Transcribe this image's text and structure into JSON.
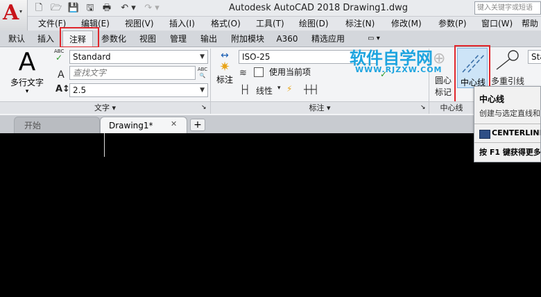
{
  "window": {
    "title": "Autodesk AutoCAD 2018    Drawing1.dwg",
    "search_placeholder": "键入关键字或短语"
  },
  "app_button": {
    "logo": "A",
    "caret": "▾"
  },
  "quick_access": {
    "new": "🗋",
    "open": "🗁",
    "save": "💾",
    "saveas": "🖫",
    "print": "🖶",
    "undo": "↶ ▾",
    "redo": "↷ ▾"
  },
  "menu": [
    "文件(F)",
    "编辑(E)",
    "视图(V)",
    "插入(I)",
    "格式(O)",
    "工具(T)",
    "绘图(D)",
    "标注(N)",
    "修改(M)",
    "参数(P)",
    "窗口(W)",
    "帮助"
  ],
  "ribbon_tabs": [
    "默认",
    "插入",
    "注释",
    "参数化",
    "视图",
    "管理",
    "输出",
    "附加模块",
    "A360",
    "精选应用",
    "▭ ▾"
  ],
  "active_tab_index": 2,
  "text_panel": {
    "big_letter": "A",
    "mtext_label": "多行文字",
    "mtext_caret": "▾",
    "style_value": "Standard",
    "find_placeholder": "查找文字",
    "height_value": "2.5",
    "abc": "ABC",
    "title": "文字 ▾",
    "corner": "↘"
  },
  "dim_panel": {
    "dim_label": "标注",
    "dim_caret": "▾",
    "style_value": "ISO-25",
    "use_current": "使用当前项",
    "linear": "线性",
    "title": "标注 ▾",
    "corner": "↘"
  },
  "center_panel": {
    "center_mark_line1": "圆心",
    "center_mark_line2": "标记",
    "centerline_label": "中心线",
    "title": "中心线"
  },
  "leader_panel": {
    "multileader_label": "多重引线",
    "style_partial": "Sta"
  },
  "doc_tabs": {
    "start": "开始",
    "drawing": "Drawing1*",
    "close": "✕",
    "add": "+"
  },
  "tooltip": {
    "title": "中心线",
    "desc": "创建与选定直线和",
    "command": "CENTERLINE",
    "help": "按 F1 键获得更多"
  },
  "watermark": {
    "text": "软件自学网",
    "url": "WWW.RJZXW.COM"
  },
  "colors": {
    "highlight": "#e0262c",
    "accent_blue": "#1ea4df",
    "logo_red": "#c8141a"
  }
}
